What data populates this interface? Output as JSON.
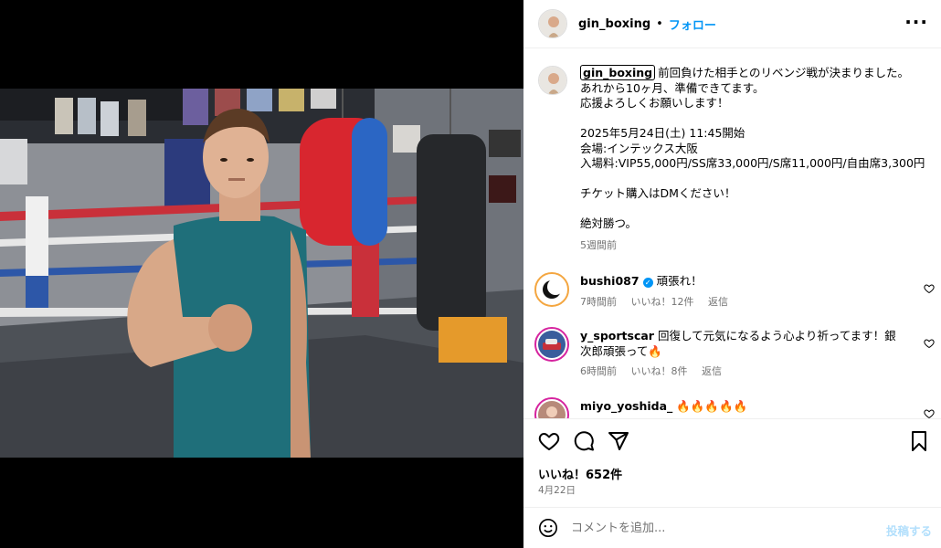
{
  "post": {
    "username": "gin_boxing",
    "follow_label": "フォロー",
    "separator": "•",
    "more_label": "···"
  },
  "caption": {
    "username": "gin_boxing",
    "text": "前回負けた相手とのリベンジ戦が決まりました。\nあれから10ヶ月、準備できてます。\n応援よろしくお願いします！\n\n2025年5月24日(土) 11:45開始\n会場:インテックス大阪\n入場料:VIP55,000円/SS席33,000円/S席11,000円/自由席3,300円\n\nチケット購入はDMください！\n\n絶対勝つ。",
    "time": "5週間前"
  },
  "comments": [
    {
      "username": "bushi087",
      "verified": true,
      "text": "頑張れ！",
      "time": "7時間前",
      "likes": "いいね！12件",
      "reply": "返信"
    },
    {
      "username": "y_sportscar",
      "verified": false,
      "text": "回復して元気になるよう心より祈ってます！銀次郎頑張って🔥",
      "time": "6時間前",
      "likes": "いいね！8件",
      "reply": "返信"
    },
    {
      "username": "miyo_yoshida_",
      "verified": false,
      "text": "🔥🔥🔥🔥🔥"
    }
  ],
  "actions": {
    "likes_text": "いいね！652件",
    "date_text": "4月22日"
  },
  "add_comment": {
    "placeholder": "コメントを追加...",
    "post_label": "投稿する"
  },
  "colors": {
    "accent": "#0095f6",
    "secondary_text": "#737373",
    "post_disabled": "#b2dffc",
    "shirt": "#1f6f7a"
  },
  "icons": [
    "heart-icon",
    "comment-icon",
    "share-icon",
    "bookmark-icon",
    "emoji-icon",
    "verified-icon",
    "more-icon"
  ]
}
